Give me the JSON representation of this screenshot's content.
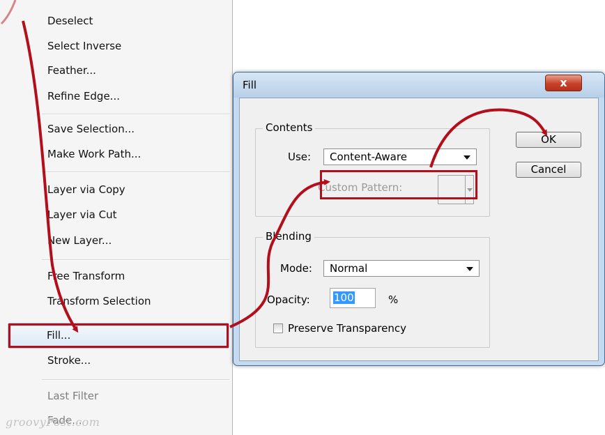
{
  "menu": {
    "items": [
      {
        "label": "Deselect",
        "disabled": false
      },
      {
        "label": "Select Inverse",
        "disabled": false
      },
      {
        "label": "Feather...",
        "disabled": false
      },
      {
        "label": "Refine Edge...",
        "disabled": false
      },
      {
        "label": "Save Selection...",
        "disabled": false
      },
      {
        "label": "Make Work Path...",
        "disabled": false
      },
      {
        "label": "Layer via Copy",
        "disabled": false
      },
      {
        "label": "Layer via Cut",
        "disabled": false
      },
      {
        "label": "New Layer...",
        "disabled": false
      },
      {
        "label": "Free Transform",
        "disabled": false
      },
      {
        "label": "Transform Selection",
        "disabled": false
      },
      {
        "label": "Fill...",
        "disabled": false,
        "highlighted": true
      },
      {
        "label": "Stroke...",
        "disabled": false
      },
      {
        "label": "Last Filter",
        "disabled": true
      },
      {
        "label": "Fade...",
        "disabled": true
      }
    ]
  },
  "dialog": {
    "title": "Fill",
    "close_symbol": "x",
    "contents_group": "Contents",
    "use_label": "Use:",
    "use_value": "Content-Aware",
    "custom_pattern_label": "Custom Pattern:",
    "blending_group": "Blending",
    "mode_label": "Mode:",
    "mode_value": "Normal",
    "opacity_label": "Opacity:",
    "opacity_value": "100",
    "opacity_unit": "%",
    "preserve_label": "Preserve Transparency",
    "ok_label": "OK",
    "cancel_label": "Cancel"
  },
  "watermark": "groovyPost.com",
  "colors": {
    "annotation_red": "#b30e1b",
    "dialog_frame": "#c5daef",
    "selection_blue": "#3399ff"
  }
}
